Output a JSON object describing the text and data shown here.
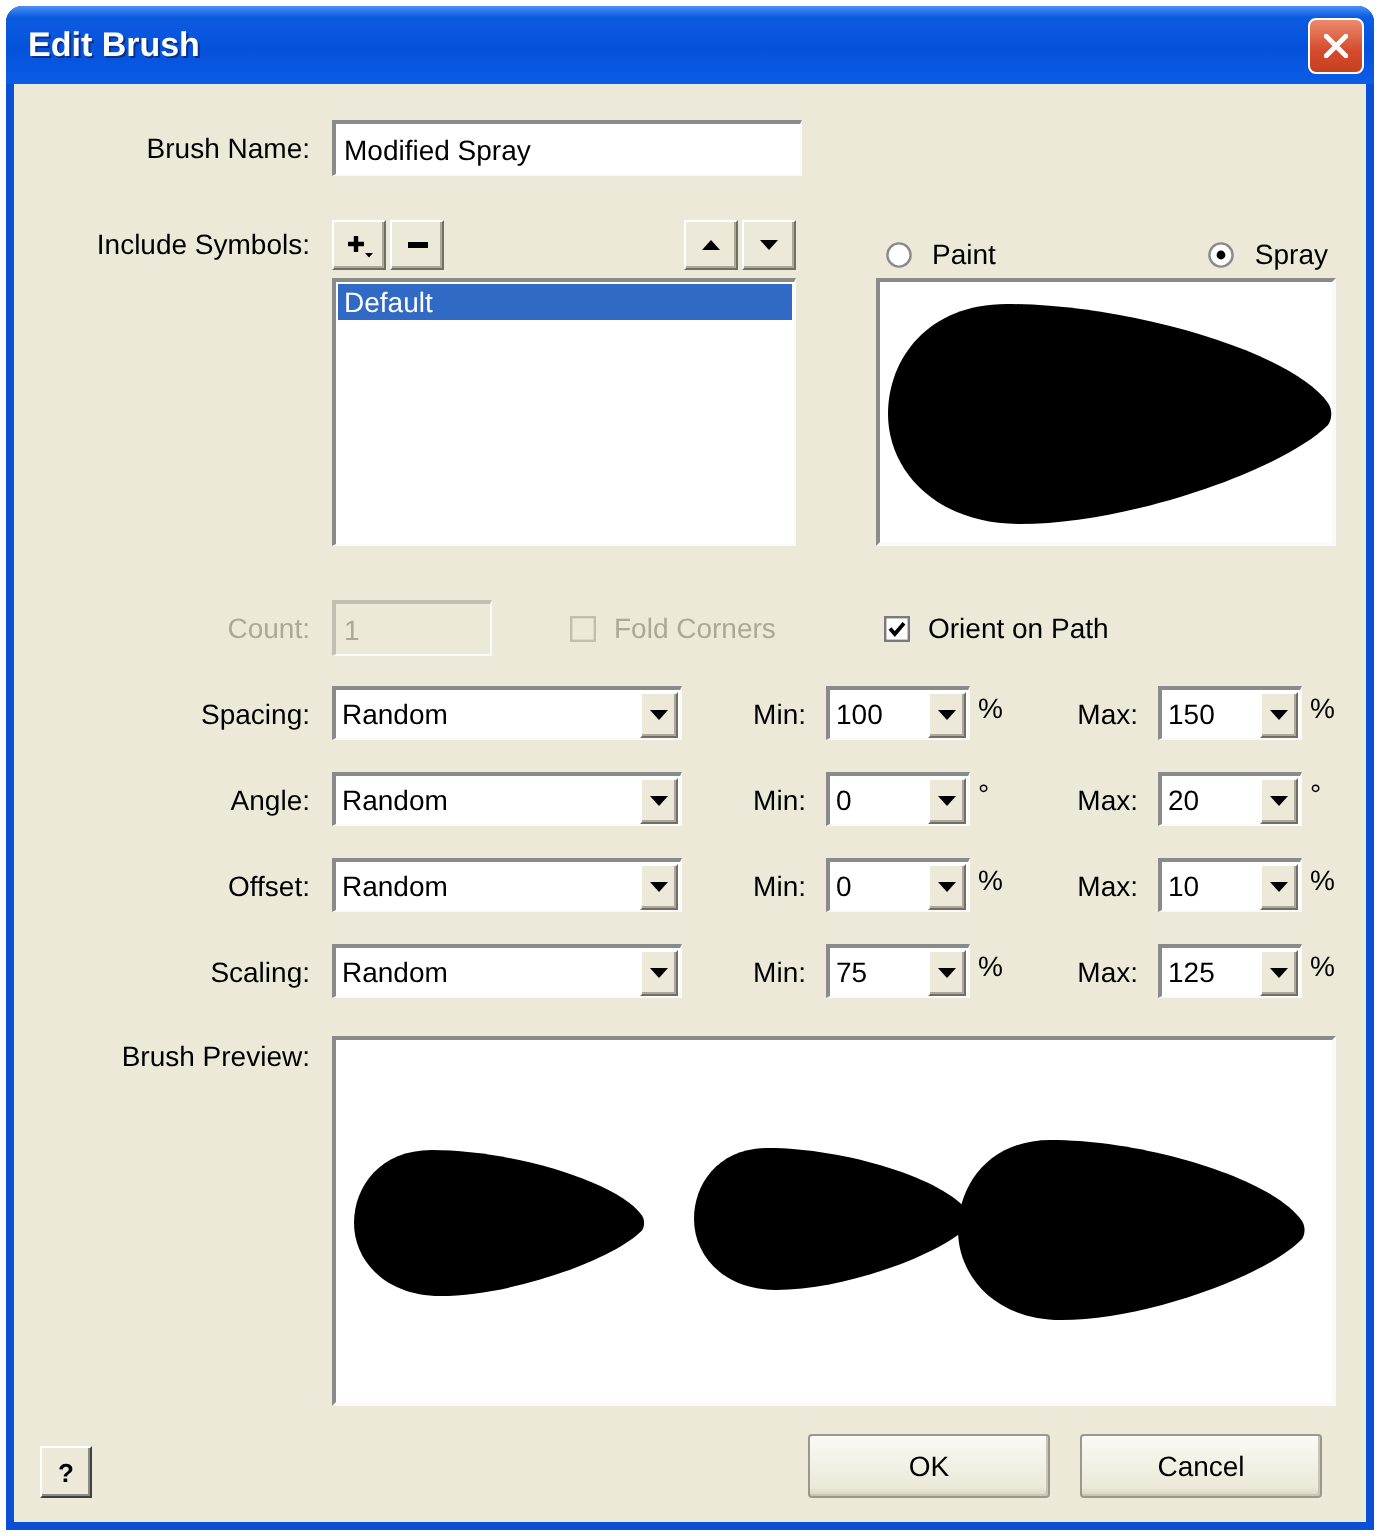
{
  "window": {
    "title": "Edit Brush"
  },
  "brush_name": {
    "label": "Brush Name:",
    "value": "Modified Spray"
  },
  "include_symbols": {
    "label": "Include Symbols:",
    "items": [
      {
        "label": "Default",
        "selected": true
      }
    ]
  },
  "brush_type": [
    {
      "label": "Paint",
      "selected": false
    },
    {
      "label": "Spray",
      "selected": true
    }
  ],
  "count": {
    "label": "Count:",
    "value": "1",
    "disabled": true
  },
  "options": [
    {
      "label": "Fold Corners",
      "checked": false,
      "disabled": true
    },
    {
      "label": "Orient on Path",
      "checked": true,
      "disabled": false
    }
  ],
  "parameters": [
    {
      "label": "Spacing:",
      "mode": "Random",
      "min_label": "Min:",
      "min": "100",
      "min_unit": "%",
      "max_label": "Max:",
      "max": "150",
      "max_unit": "%"
    },
    {
      "label": "Angle:",
      "mode": "Random",
      "min_label": "Min:",
      "min": "0",
      "min_unit": "°",
      "max_label": "Max:",
      "max": "20",
      "max_unit": "°"
    },
    {
      "label": "Offset:",
      "mode": "Random",
      "min_label": "Min:",
      "min": "0",
      "min_unit": "%",
      "max_label": "Max:",
      "max": "10",
      "max_unit": "%"
    },
    {
      "label": "Scaling:",
      "mode": "Random",
      "min_label": "Min:",
      "min": "75",
      "min_unit": "%",
      "max_label": "Max:",
      "max": "125",
      "max_unit": "%"
    }
  ],
  "brush_preview": {
    "label": "Brush Preview:"
  },
  "help_button": {
    "glyph": "?"
  },
  "buttons": [
    {
      "label": "OK"
    },
    {
      "label": "Cancel"
    }
  ]
}
